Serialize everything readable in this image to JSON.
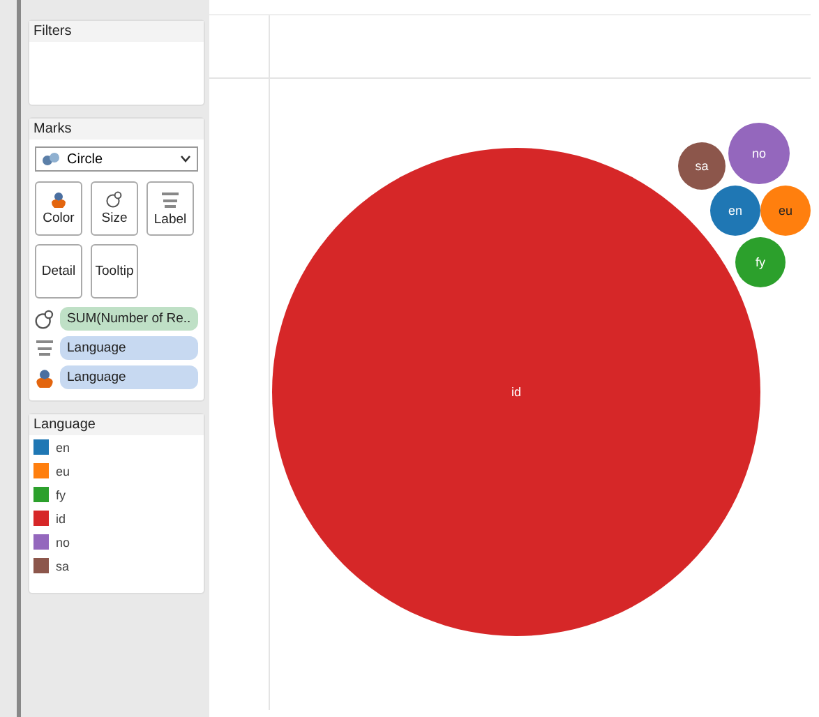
{
  "filters": {
    "title": "Filters"
  },
  "marks": {
    "title": "Marks",
    "mark_type": "Circle",
    "cards": [
      {
        "label": "Color",
        "kind": "color"
      },
      {
        "label": "Size",
        "kind": "size"
      },
      {
        "label": "Label",
        "kind": "label"
      },
      {
        "label": "Detail",
        "kind": "detail"
      },
      {
        "label": "Tooltip",
        "kind": "tooltip"
      }
    ],
    "shelf": [
      {
        "field": "SUM(Number of Re..",
        "kind": "size",
        "measure": true
      },
      {
        "field": "Language",
        "kind": "label",
        "measure": false
      },
      {
        "field": "Language",
        "kind": "color",
        "measure": false
      }
    ]
  },
  "legend": {
    "title": "Language",
    "items": [
      {
        "label": "en",
        "color": "#1f77b4"
      },
      {
        "label": "eu",
        "color": "#ff7f0e"
      },
      {
        "label": "fy",
        "color": "#2ca02c"
      },
      {
        "label": "id",
        "color": "#d62728"
      },
      {
        "label": "no",
        "color": "#9467bd"
      },
      {
        "label": "sa",
        "color": "#8c564b"
      }
    ]
  },
  "bubbles": [
    {
      "label": "id",
      "color": "#d62728"
    },
    {
      "label": "sa",
      "color": "#8c564b"
    },
    {
      "label": "no",
      "color": "#9467bd"
    },
    {
      "label": "en",
      "color": "#1f77b4"
    },
    {
      "label": "eu",
      "color": "#ff7f0e"
    },
    {
      "label": "fy",
      "color": "#2ca02c"
    }
  ]
}
